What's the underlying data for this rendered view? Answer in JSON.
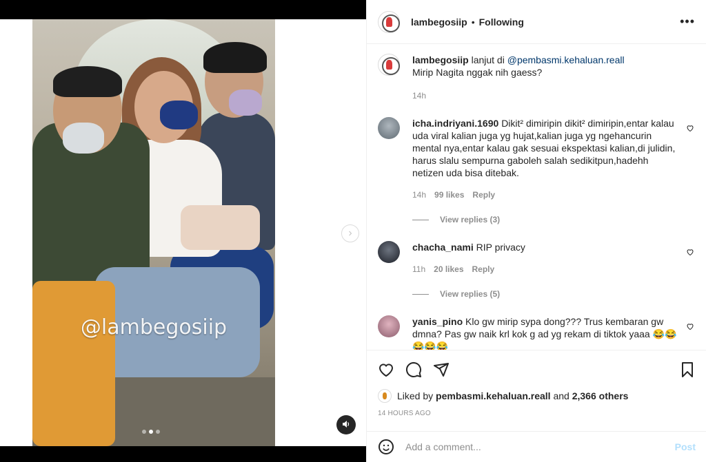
{
  "post": {
    "username": "lambegosiip",
    "follow_status": "Following",
    "more_icon": "more-horizontal-icon",
    "watermark": "@lambegosiip",
    "carousel": {
      "dots": 3,
      "active_index": 1
    }
  },
  "caption": {
    "username": "lambegosiip",
    "prefix": "lanjut di",
    "mention": "@pembasmi.kehaluan.reall",
    "text": "Mirip Nagita nggak nih gaess?",
    "time": "14h"
  },
  "comments": [
    {
      "username": "icha.indriyani.1690",
      "text": "Dikit² dimiripin dikit² dimiripin,entar kalau uda viral kalian juga yg hujat,kalian juga yg ngehancurin mental nya,entar kalau gak sesuai ekspektasi kalian,di julidin, harus slalu sempurna gaboleh salah sedikitpun,hadehh netizen uda bisa ditebak.",
      "time": "14h",
      "likes": "99 likes",
      "reply": "Reply",
      "view_replies": "View replies (3)"
    },
    {
      "username": "chacha_nami",
      "text": "RIP privacy",
      "time": "11h",
      "likes": "20 likes",
      "reply": "Reply",
      "view_replies": "View replies (5)"
    },
    {
      "username": "yanis_pino",
      "text": "Klo gw mirip sypa dong??? Trus kembaran gw dmna? Pas gw naik krl kok g ad yg rekam di tiktok yaaa 😂😂 😂😂😂"
    }
  ],
  "actions": {
    "liked_prefix": "Liked by",
    "liked_user": "pembasmi.kehaluan.reall",
    "liked_and": "and",
    "liked_others": "2,366 others",
    "timestamp": "14 HOURS AGO"
  },
  "add_comment": {
    "placeholder": "Add a comment...",
    "post_label": "Post"
  },
  "colors": {
    "link": "#00376b",
    "muted": "#8e8e8e",
    "post_disabled": "#b2dffc"
  }
}
